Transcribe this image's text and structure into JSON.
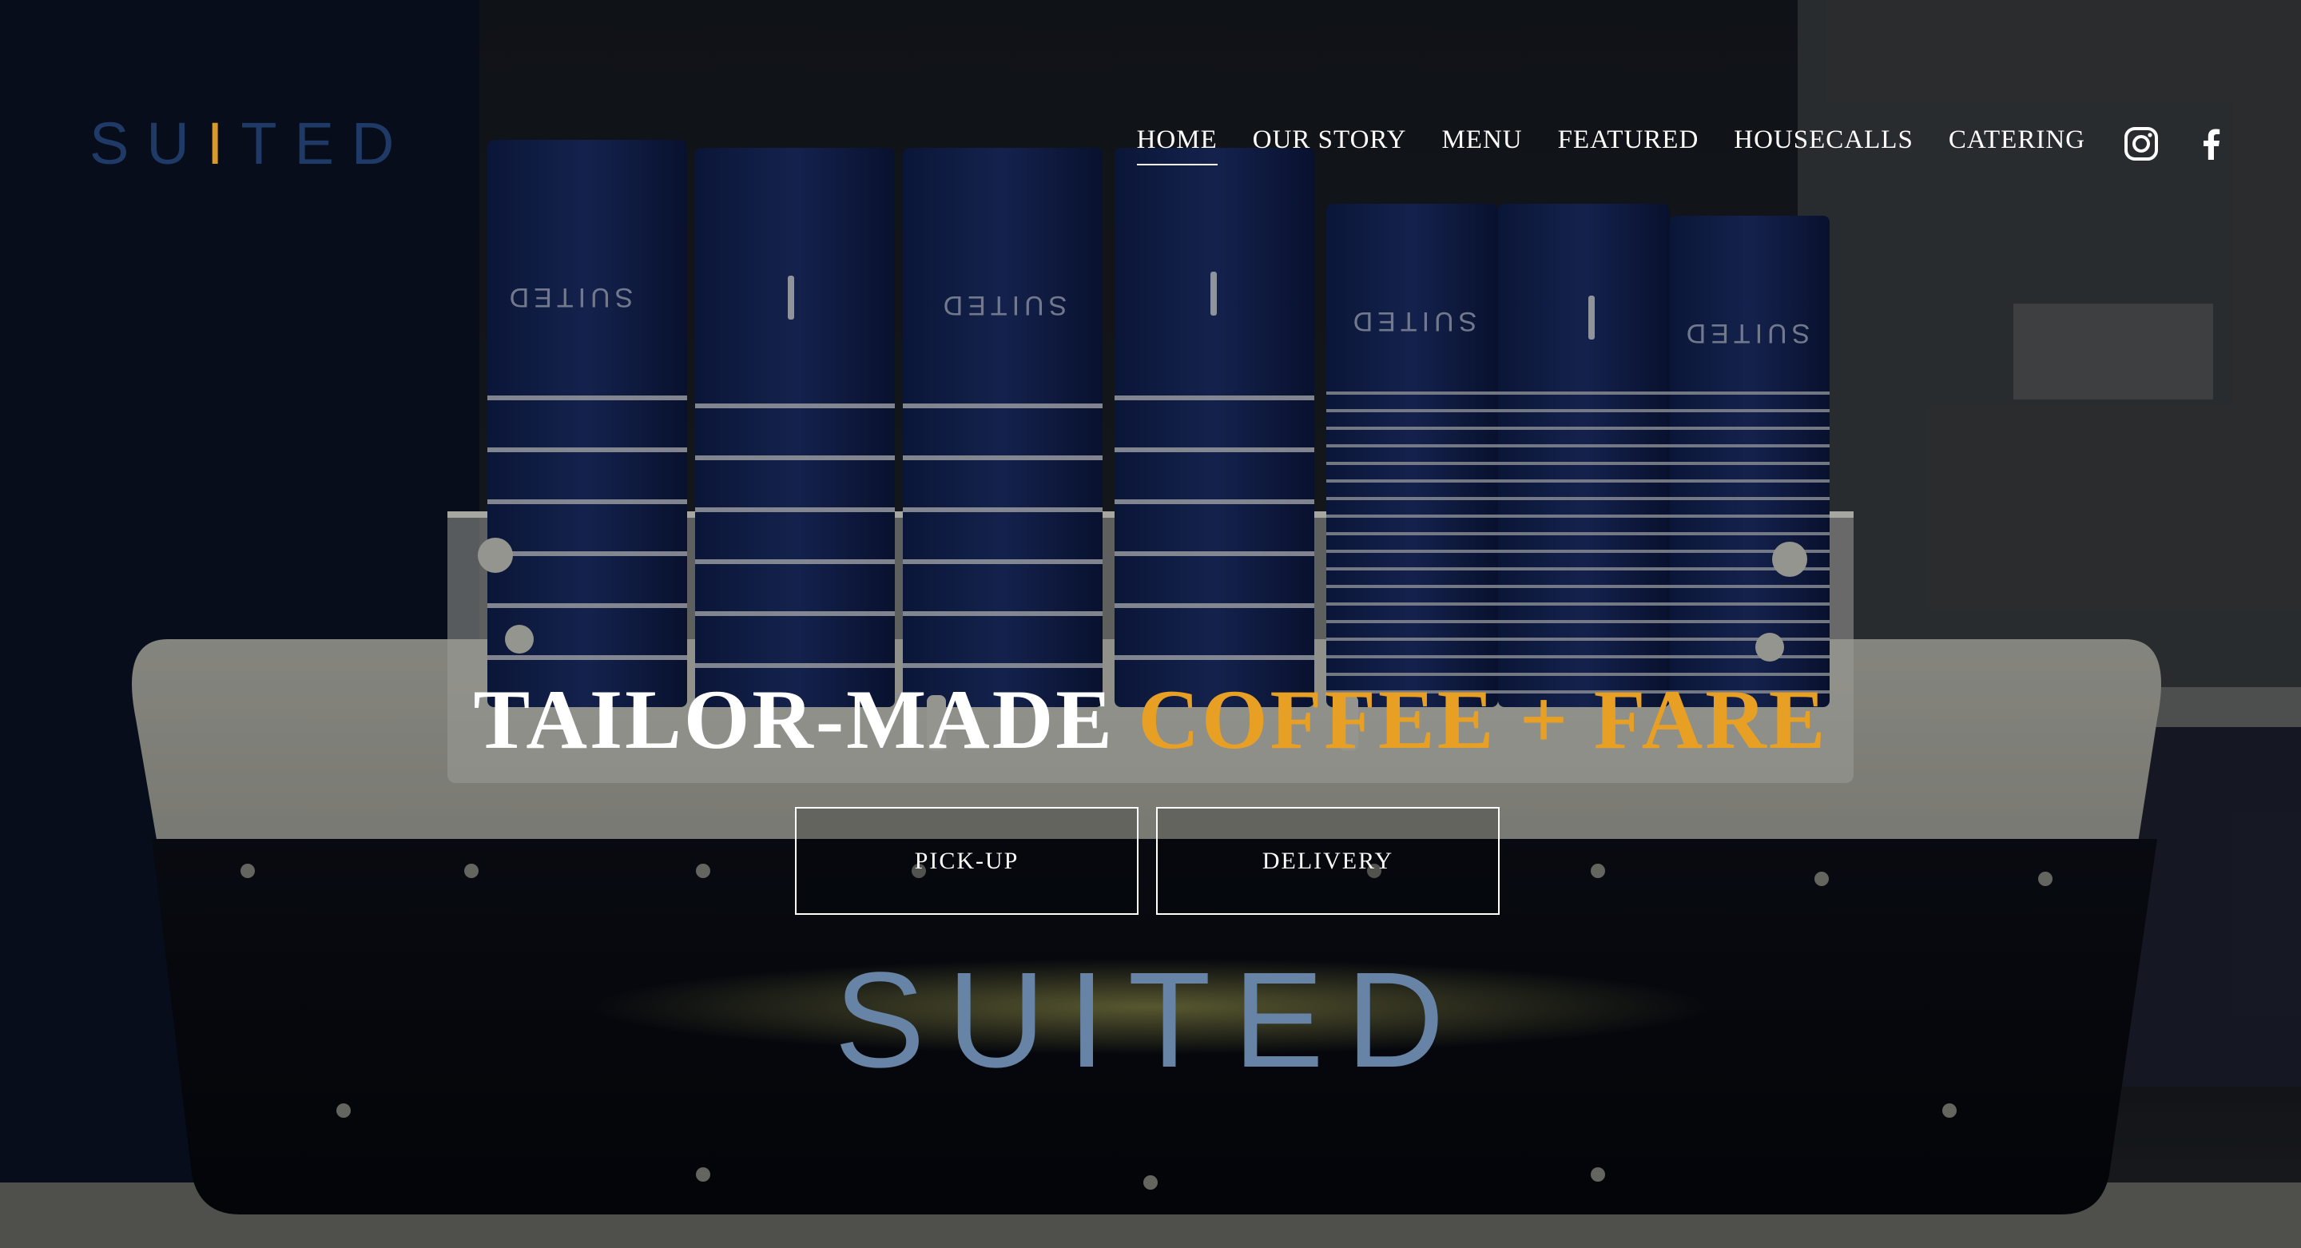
{
  "brand": {
    "logo_text_left": "SU",
    "logo_tie": "I",
    "logo_text_right": "TED",
    "accent_gold": "#e8a024",
    "logo_navy": "#1f3a66"
  },
  "nav": [
    {
      "label": "HOME",
      "active": true
    },
    {
      "label": "OUR STORY"
    },
    {
      "label": "MENU"
    },
    {
      "label": "FEATURED"
    },
    {
      "label": "HOUSECALLS"
    },
    {
      "label": "CATERING"
    }
  ],
  "social": [
    {
      "icon": "instagram-icon"
    },
    {
      "icon": "facebook-icon"
    }
  ],
  "hero": {
    "headline_white": "TAILOR-MADE",
    "headline_gold": "COFFEE + FARE",
    "buttons": [
      {
        "label": "PICK-UP"
      },
      {
        "label": "DELIVERY"
      }
    ],
    "machine_text": "SUITED",
    "cup_text": "SUITED"
  }
}
